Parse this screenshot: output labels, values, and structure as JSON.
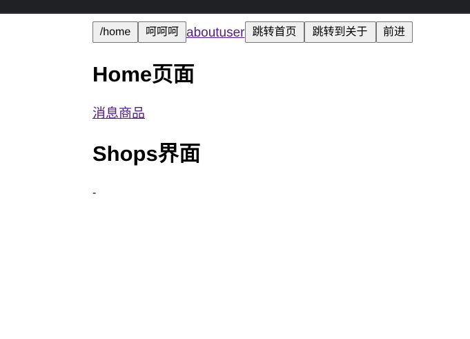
{
  "nav": {
    "home_button_label": "/home",
    "hehe_button_label": "呵呵呵",
    "about_link_text": "aboutuser",
    "jump_home_button_label": "跳转首页",
    "jump_about_button_label": "跳转到关于",
    "forward_button_label": "前进"
  },
  "home": {
    "title": "Home页面",
    "news_link_text": "消息商品"
  },
  "shops": {
    "title": "Shops界面",
    "content": "-"
  }
}
